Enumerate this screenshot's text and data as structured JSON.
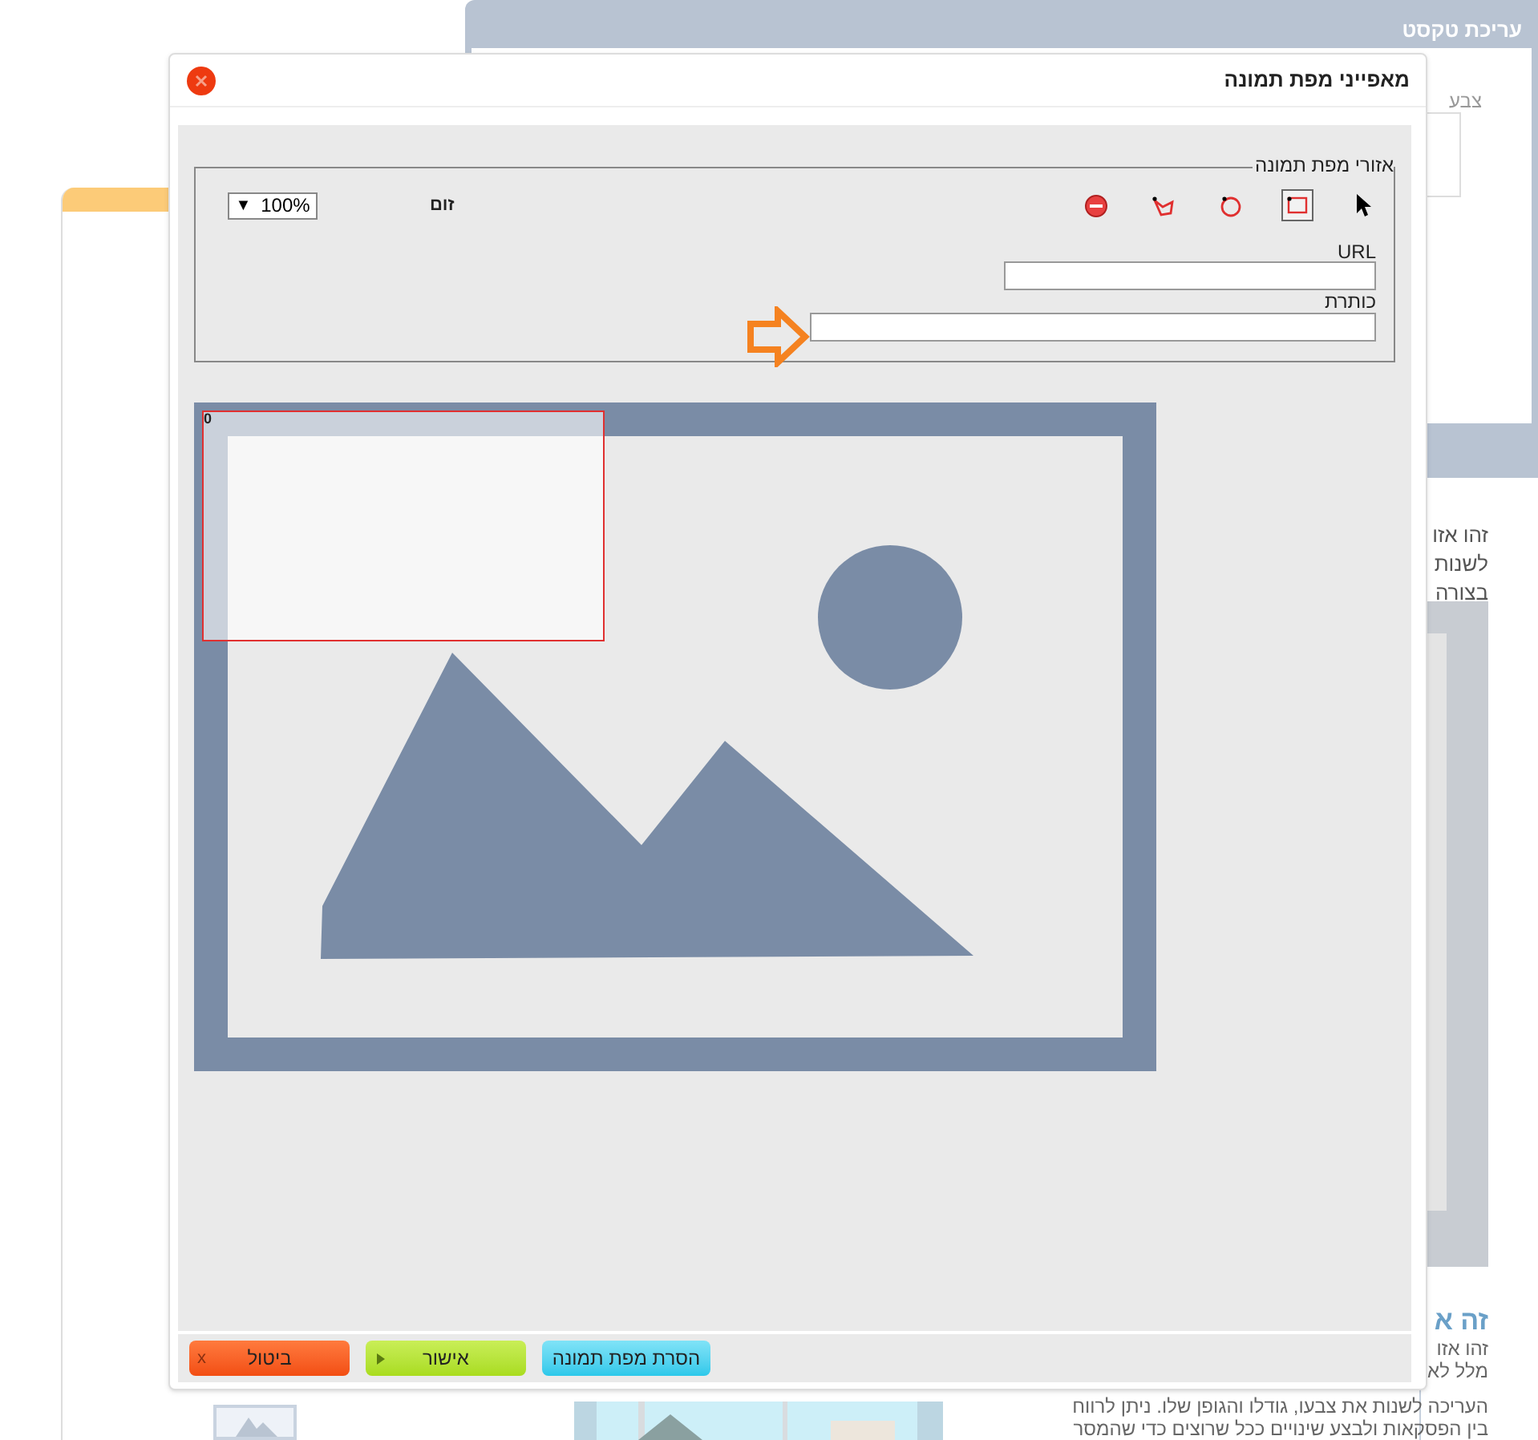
{
  "background_panel": {
    "title": "עריכת טקסט",
    "field_label": "צבע"
  },
  "page_text": {
    "intro_lines": [
      "זהו אזו",
      "לשנות",
      "בצורה"
    ],
    "heading": "זה א",
    "body_lines": [
      "זהו אזו",
      "מלל לא",
      "העריכה לשנות את צבעו, גודלו והגופן שלו. ניתן לרווח",
      "בין הפסקאות ולבצע שינויים ככל שרוצים כדי שהמסר"
    ]
  },
  "dialog": {
    "title": "מאפייני מפת תמונה",
    "areas": {
      "legend": "אזורי מפת תמונה",
      "tools": [
        {
          "kind": "pointer",
          "selected": false
        },
        {
          "kind": "rectangle",
          "selected": true
        },
        {
          "kind": "circle",
          "selected": false
        },
        {
          "kind": "polygon",
          "selected": false
        },
        {
          "kind": "delete",
          "selected": false
        }
      ],
      "zoom_label": "זום",
      "zoom_value": "100%",
      "zoom_caret": "▼",
      "url_label": "URL",
      "title_label": "כותרת"
    },
    "regions": [
      {
        "label": "0"
      }
    ],
    "buttons": [
      {
        "kind": "remove",
        "label": "הסרת מפת תמונה"
      },
      {
        "kind": "ok",
        "label": "אישור"
      },
      {
        "kind": "cancel",
        "label": "ביטול",
        "icon_text": "x"
      }
    ]
  }
}
